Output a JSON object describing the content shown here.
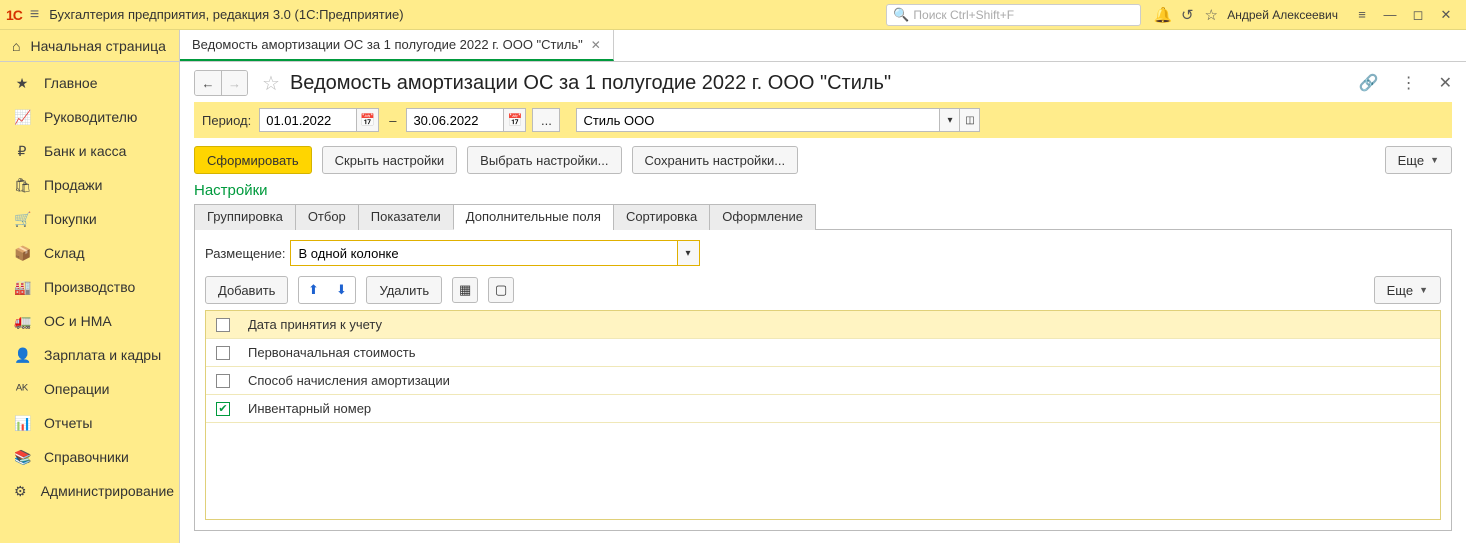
{
  "app": {
    "title": "Бухгалтерия предприятия, редакция 3.0  (1С:Предприятие)",
    "search_placeholder": "Поиск Ctrl+Shift+F",
    "user": "Андрей Алексеевич"
  },
  "home_tab": "Начальная страница",
  "open_tab": "Ведомость амортизации ОС за 1 полугодие 2022 г. ООО \"Стиль\"",
  "sidebar": [
    {
      "icon": "★",
      "label": "Главное"
    },
    {
      "icon": "📈",
      "label": "Руководителю"
    },
    {
      "icon": "₽",
      "label": "Банк и касса"
    },
    {
      "icon": "🛍",
      "label": "Продажи"
    },
    {
      "icon": "🛒",
      "label": "Покупки"
    },
    {
      "icon": "📦",
      "label": "Склад"
    },
    {
      "icon": "🏭",
      "label": "Производство"
    },
    {
      "icon": "🚛",
      "label": "ОС и НМА"
    },
    {
      "icon": "👤",
      "label": "Зарплата и кадры"
    },
    {
      "icon": "ᴬᴷ",
      "label": "Операции"
    },
    {
      "icon": "📊",
      "label": "Отчеты"
    },
    {
      "icon": "📚",
      "label": "Справочники"
    },
    {
      "icon": "⚙",
      "label": "Администрирование"
    }
  ],
  "page": {
    "title": "Ведомость амортизации ОС за 1 полугодие 2022 г. ООО \"Стиль\""
  },
  "period": {
    "label": "Период:",
    "from": "01.01.2022",
    "to": "30.06.2022",
    "org": "Стиль ООО",
    "dash": "–"
  },
  "actions": {
    "form": "Сформировать",
    "hide": "Скрыть настройки",
    "select": "Выбрать настройки...",
    "save": "Сохранить настройки...",
    "more": "Еще"
  },
  "settings_label": "Настройки",
  "tabs": [
    "Группировка",
    "Отбор",
    "Показатели",
    "Дополнительные поля",
    "Сортировка",
    "Оформление"
  ],
  "active_tab_index": 3,
  "placement": {
    "label": "Размещение:",
    "value": "В одной колонке"
  },
  "tools": {
    "add": "Добавить",
    "delete": "Удалить",
    "more": "Еще"
  },
  "fields": [
    {
      "checked": false,
      "label": "Дата принятия к учету",
      "header": true
    },
    {
      "checked": false,
      "label": "Первоначальная стоимость"
    },
    {
      "checked": false,
      "label": "Способ начисления амортизации"
    },
    {
      "checked": true,
      "label": "Инвентарный номер"
    }
  ],
  "dots": "..."
}
